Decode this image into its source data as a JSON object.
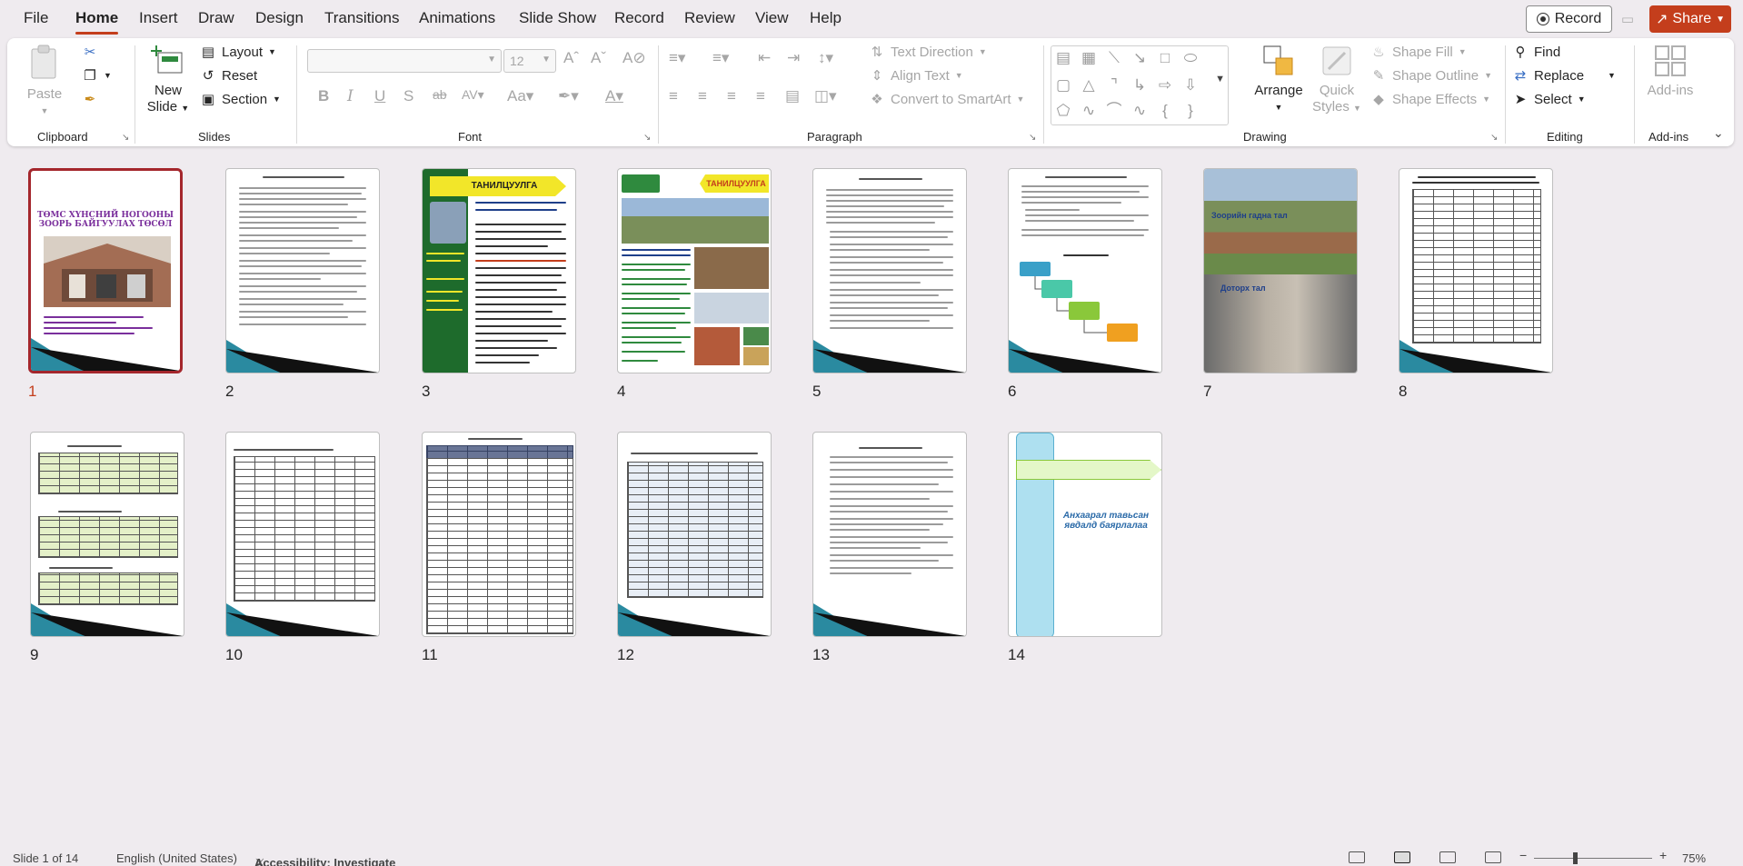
{
  "menu": {
    "tabs": [
      "File",
      "Home",
      "Insert",
      "Draw",
      "Design",
      "Transitions",
      "Animations",
      "Slide Show",
      "Record",
      "Review",
      "View",
      "Help"
    ],
    "active_tab": "Home",
    "record_label": "Record",
    "share_label": "Share"
  },
  "ribbon": {
    "clipboard": {
      "label": "Clipboard",
      "paste": "Paste"
    },
    "slides": {
      "label": "Slides",
      "new_slide_line1": "New",
      "new_slide_line2": "Slide",
      "layout": "Layout",
      "reset": "Reset",
      "section": "Section"
    },
    "font": {
      "label": "Font",
      "font_size": "12"
    },
    "paragraph": {
      "label": "Paragraph",
      "text_direction": "Text Direction",
      "align_text": "Align Text",
      "convert_smartart": "Convert to SmartArt"
    },
    "drawing": {
      "label": "Drawing",
      "arrange": "Arrange",
      "quick_styles_line1": "Quick",
      "quick_styles_line2": "Styles",
      "shape_fill": "Shape Fill",
      "shape_outline": "Shape Outline",
      "shape_effects": "Shape Effects"
    },
    "editing": {
      "label": "Editing",
      "find": "Find",
      "replace": "Replace",
      "select": "Select"
    },
    "addins": {
      "label": "Add-ins",
      "addins_btn": "Add-ins"
    }
  },
  "slides": [
    {
      "num": "1",
      "title_line1": "ТӨМС ХҮНСНИЙ НОГООНЫ",
      "title_line2": "ЗООРЬ БАЙГУУЛАХ ТӨСӨЛ"
    },
    {
      "num": "2"
    },
    {
      "num": "3",
      "banner": "ТАНИЛЦУУЛГА"
    },
    {
      "num": "4",
      "banner": "ТАНИЛЦУУЛГА"
    },
    {
      "num": "5"
    },
    {
      "num": "6"
    },
    {
      "num": "7",
      "caption_top": "Зоорийн гадна тал",
      "caption_bottom": "Доторх тал"
    },
    {
      "num": "8"
    },
    {
      "num": "9"
    },
    {
      "num": "10"
    },
    {
      "num": "11"
    },
    {
      "num": "12"
    },
    {
      "num": "13"
    },
    {
      "num": "14",
      "closing_line1": "Анхаарал тавьсан",
      "closing_line2": "явдалд баярлалаа"
    }
  ],
  "status": {
    "slide_info": "Slide 1 of 14",
    "language": "English (United States)",
    "accessibility": "Accessibility: Investigate",
    "zoom": "75%"
  },
  "colors": {
    "accent": "#c43e1c",
    "selection": "#a4262c"
  }
}
